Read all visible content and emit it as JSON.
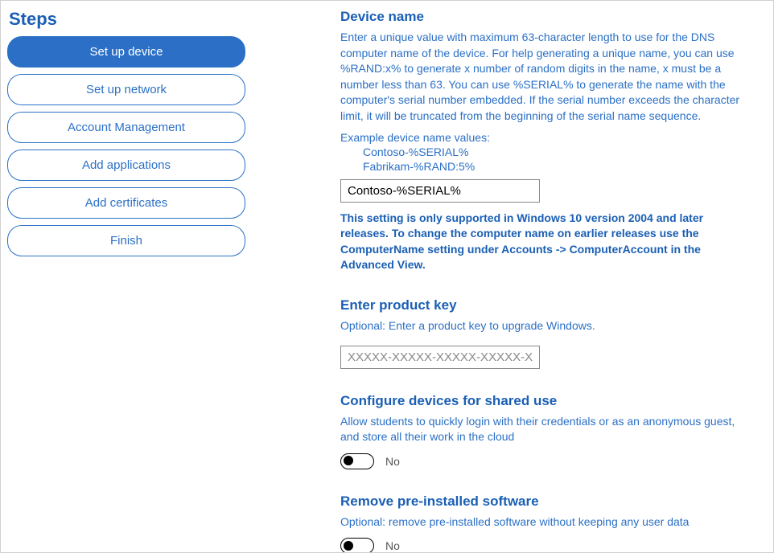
{
  "sidebar": {
    "title": "Steps",
    "items": [
      {
        "label": "Set up device",
        "active": true
      },
      {
        "label": "Set up network",
        "active": false
      },
      {
        "label": "Account Management",
        "active": false
      },
      {
        "label": "Add applications",
        "active": false
      },
      {
        "label": "Add certificates",
        "active": false
      },
      {
        "label": "Finish",
        "active": false
      }
    ]
  },
  "deviceName": {
    "heading": "Device name",
    "description": "Enter a unique value with maximum 63-character length to use for the DNS computer name of the device. For help generating a unique name, you can use %RAND:x% to generate x number of random digits in the name, x must be a number less than 63. You can use %SERIAL% to generate the name with the computer's serial number embedded. If the serial number exceeds the character limit, it will be truncated from the beginning of the serial name sequence.",
    "examplesLabel": "Example device name values:",
    "examples": [
      "Contoso-%SERIAL%",
      "Fabrikam-%RAND:5%"
    ],
    "inputValue": "Contoso-%SERIAL%",
    "note": "This setting is only supported in Windows 10 version 2004 and later releases. To change the computer name on earlier releases use the ComputerName setting under Accounts -> ComputerAccount in the Advanced View."
  },
  "productKey": {
    "heading": "Enter product key",
    "description": "Optional: Enter a product key to upgrade Windows.",
    "placeholder": "XXXXX-XXXXX-XXXXX-XXXXX-XXXXX",
    "value": ""
  },
  "sharedUse": {
    "heading": "Configure devices for shared use",
    "description": "Allow students to quickly login with their credentials or as an anonymous guest, and store all their work in the cloud",
    "toggleLabel": "No"
  },
  "removeSoftware": {
    "heading": "Remove pre-installed software",
    "description": "Optional: remove pre-installed software without keeping any user data",
    "toggleLabel": "No"
  }
}
